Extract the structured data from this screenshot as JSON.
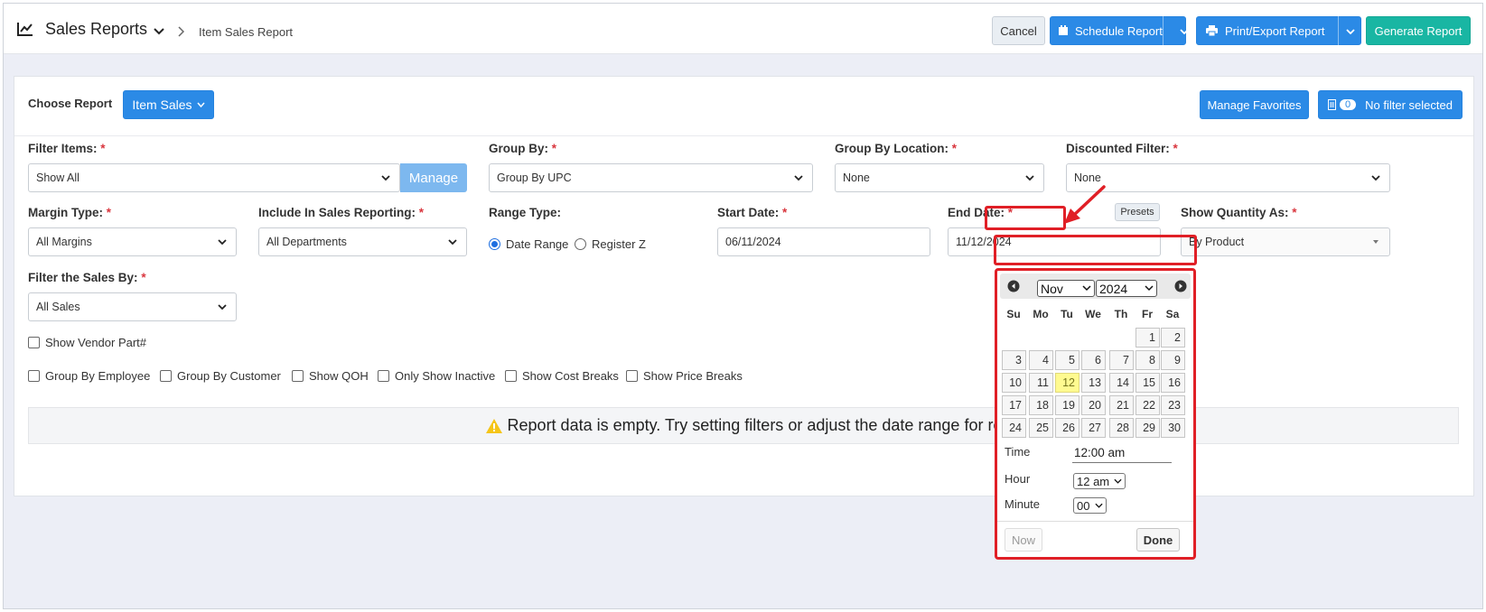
{
  "header": {
    "title": "Sales Reports",
    "breadcrumb": "Item Sales Report",
    "cancel": "Cancel",
    "schedule": "Schedule Report",
    "print_export": "Print/Export Report",
    "generate": "Generate Report"
  },
  "report_bar": {
    "choose_label": "Choose Report",
    "report_button": "Item Sales",
    "manage_favorites": "Manage Favorites",
    "filter_count": "0",
    "filter_status": "No filter selected"
  },
  "fields": {
    "filter_items": {
      "label": "Filter Items:",
      "value": "Show All",
      "manage": "Manage"
    },
    "group_by": {
      "label": "Group By:",
      "value": "Group By UPC"
    },
    "group_by_location": {
      "label": "Group By Location:",
      "value": "None"
    },
    "discounted_filter": {
      "label": "Discounted Filter:",
      "value": "None"
    },
    "margin_type": {
      "label": "Margin Type:",
      "value": "All Margins"
    },
    "include_in_sales": {
      "label": "Include In Sales Reporting:",
      "value": "All Departments"
    },
    "range_type": {
      "label": "Range Type:",
      "opt1": "Date Range",
      "opt2": "Register Z"
    },
    "start_date": {
      "label": "Start Date:",
      "value": "06/11/2024"
    },
    "end_date": {
      "label": "End Date:",
      "value": "11/12/2024",
      "presets": "Presets"
    },
    "show_quantity": {
      "label": "Show Quantity As:",
      "value": "By Product"
    },
    "filter_sales_by": {
      "label": "Filter the Sales By:",
      "value": "All Sales"
    },
    "required_mark": "*"
  },
  "checkboxes": {
    "vendor_part": "Show Vendor Part#",
    "group_employee": "Group By Employee",
    "group_customer": "Group By Customer",
    "show_qoh": "Show QOH",
    "only_inactive": "Only Show Inactive",
    "cost_breaks": "Show Cost Breaks",
    "price_breaks": "Show Price Breaks"
  },
  "notice": "Report data is empty. Try setting filters or adjust the date range for re",
  "datepicker": {
    "month": "Nov",
    "year": "2024",
    "dow": [
      "Su",
      "Mo",
      "Tu",
      "We",
      "Th",
      "Fr",
      "Sa"
    ],
    "weeks": [
      [
        "",
        "",
        "",
        "",
        "",
        "1",
        "2"
      ],
      [
        "3",
        "4",
        "5",
        "6",
        "7",
        "8",
        "9"
      ],
      [
        "10",
        "11",
        "12",
        "13",
        "14",
        "15",
        "16"
      ],
      [
        "17",
        "18",
        "19",
        "20",
        "21",
        "22",
        "23"
      ],
      [
        "24",
        "25",
        "26",
        "27",
        "28",
        "29",
        "30"
      ]
    ],
    "today": "12",
    "time_label": "Time",
    "time_value": "12:00 am",
    "hour_label": "Hour",
    "hour_value": "12 am",
    "minute_label": "Minute",
    "minute_value": "00",
    "now": "Now",
    "done": "Done"
  },
  "colors": {
    "primary": "#2b8ae6",
    "teal": "#19b6a3",
    "highlight": "#e01f26",
    "today": "#fffa90"
  }
}
